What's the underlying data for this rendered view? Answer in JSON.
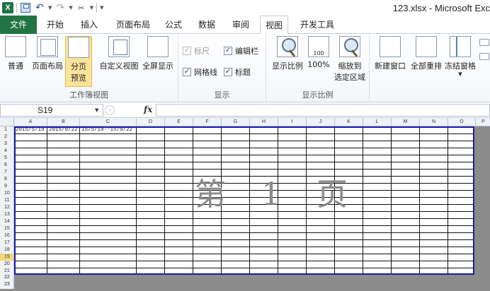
{
  "titlebar": {
    "app_icon": "excel-icon",
    "title": "123.xlsx - Microsoft Exc"
  },
  "tabs": [
    {
      "label": "文件"
    },
    {
      "label": "开始"
    },
    {
      "label": "插入"
    },
    {
      "label": "页面布局"
    },
    {
      "label": "公式"
    },
    {
      "label": "数据"
    },
    {
      "label": "审阅"
    },
    {
      "label": "视图"
    },
    {
      "label": "开发工具"
    }
  ],
  "ribbon": {
    "workbook_views": {
      "label": "工作簿视图",
      "normal": "普通",
      "page_layout": "页面布局",
      "page_break_line1": "分页",
      "page_break_line2": "预览",
      "custom_views": "自定义视图",
      "full_screen": "全屏显示"
    },
    "show": {
      "label": "显示",
      "ruler": "标尺",
      "formula_bar": "编辑栏",
      "gridlines": "网格线",
      "headings": "标题"
    },
    "zoom": {
      "label": "显示比例",
      "zoom": "显示比例",
      "hundred": "100%",
      "zoom_sel_line1": "缩放到",
      "zoom_sel_line2": "选定区域"
    },
    "window": {
      "new_window": "新建窗口",
      "arrange_all": "全部重排",
      "freeze": "冻结窗格"
    }
  },
  "formulabar": {
    "name_box": "S19",
    "fx": "fx"
  },
  "sheet": {
    "columns": [
      "A",
      "B",
      "C",
      "D",
      "E",
      "F",
      "G",
      "H",
      "I",
      "J",
      "K",
      "L",
      "M",
      "N",
      "O",
      "P"
    ],
    "rows": [
      "1",
      "2",
      "3",
      "4",
      "5",
      "6",
      "7",
      "8",
      "9",
      "10",
      "11",
      "12",
      "13",
      "14",
      "15",
      "16",
      "17",
      "18",
      "19",
      "20",
      "21"
    ],
    "below_rows": [
      "22",
      "23"
    ],
    "selected_row": "19",
    "cells": {
      "A1": "2015/5/19",
      "B1": "2015/9/22",
      "C1": "15/5/19--15/9/22"
    },
    "watermark": "第 1 页"
  }
}
